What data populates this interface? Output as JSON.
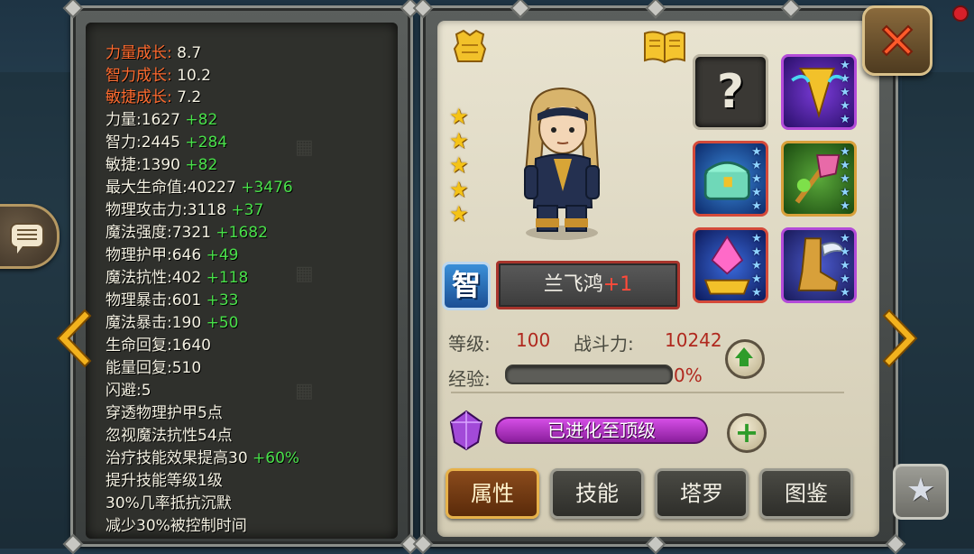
{
  "growth": [
    {
      "label": "力量成长:",
      "value": "8.7"
    },
    {
      "label": "智力成长:",
      "value": "10.2"
    },
    {
      "label": "敏捷成长:",
      "value": "7.2"
    }
  ],
  "stats": [
    {
      "label": "力量:",
      "value": "1627",
      "bonus": "+82"
    },
    {
      "label": "智力:",
      "value": "2445",
      "bonus": "+284"
    },
    {
      "label": "敏捷:",
      "value": "1390",
      "bonus": "+82"
    },
    {
      "label": "最大生命值:",
      "value": "40227",
      "bonus": "+3476"
    },
    {
      "label": "物理攻击力:",
      "value": "3118",
      "bonus": "+37"
    },
    {
      "label": "魔法强度:",
      "value": "7321",
      "bonus": "+1682"
    },
    {
      "label": "物理护甲:",
      "value": "646",
      "bonus": "+49"
    },
    {
      "label": "魔法抗性:",
      "value": "402",
      "bonus": "+118"
    },
    {
      "label": "物理暴击:",
      "value": "601",
      "bonus": "+33"
    },
    {
      "label": "魔法暴击:",
      "value": "190",
      "bonus": "+50"
    },
    {
      "label": "生命回复:",
      "value": "1640",
      "bonus": ""
    },
    {
      "label": "能量回复:",
      "value": "510",
      "bonus": ""
    },
    {
      "label": "闪避:",
      "value": "5",
      "bonus": ""
    }
  ],
  "effects": [
    {
      "text": "穿透物理护甲5点",
      "bonus": ""
    },
    {
      "text": "忽视魔法抗性54点",
      "bonus": ""
    },
    {
      "text": "治疗技能效果提高30",
      "bonus": "+60%"
    },
    {
      "text": "提升技能等级1级",
      "bonus": ""
    },
    {
      "text": "30%几率抵抗沉默",
      "bonus": ""
    },
    {
      "text": "减少30%被控制时间",
      "bonus": ""
    }
  ],
  "hero": {
    "type": "智",
    "name": "兰飞鸿",
    "plus": "+1",
    "star_count": 5,
    "level_label": "等级:",
    "level": "100",
    "power_label": "战斗力:",
    "power": "10242",
    "exp_label": "经验:",
    "exp_percent": "0%",
    "exp_fraction": 0.0,
    "evolve_status": "已进化至顶级"
  },
  "equipment": [
    {
      "name": "empty-slot",
      "glyph": "?"
    },
    {
      "name": "golden-staff"
    },
    {
      "name": "jade-chest"
    },
    {
      "name": "emerald-scepter"
    },
    {
      "name": "crystal-crown"
    },
    {
      "name": "winged-boots"
    }
  ],
  "tabs": [
    {
      "label": "属性",
      "active": true
    },
    {
      "label": "技能",
      "active": false
    },
    {
      "label": "塔罗",
      "active": false
    },
    {
      "label": "图鉴",
      "active": false
    }
  ],
  "colors": {
    "growth": "#ff6b2f",
    "bonus": "#49e04a",
    "red_value": "#b0281e",
    "evolve": "#b532c8"
  },
  "icons": {
    "close": "close-x-icon",
    "armor": "armor-icon",
    "book": "book-icon",
    "chat": "chat-bubble-icon",
    "star_btn": "star-icon",
    "prev": "arrow-left-icon",
    "next": "arrow-right-icon"
  }
}
